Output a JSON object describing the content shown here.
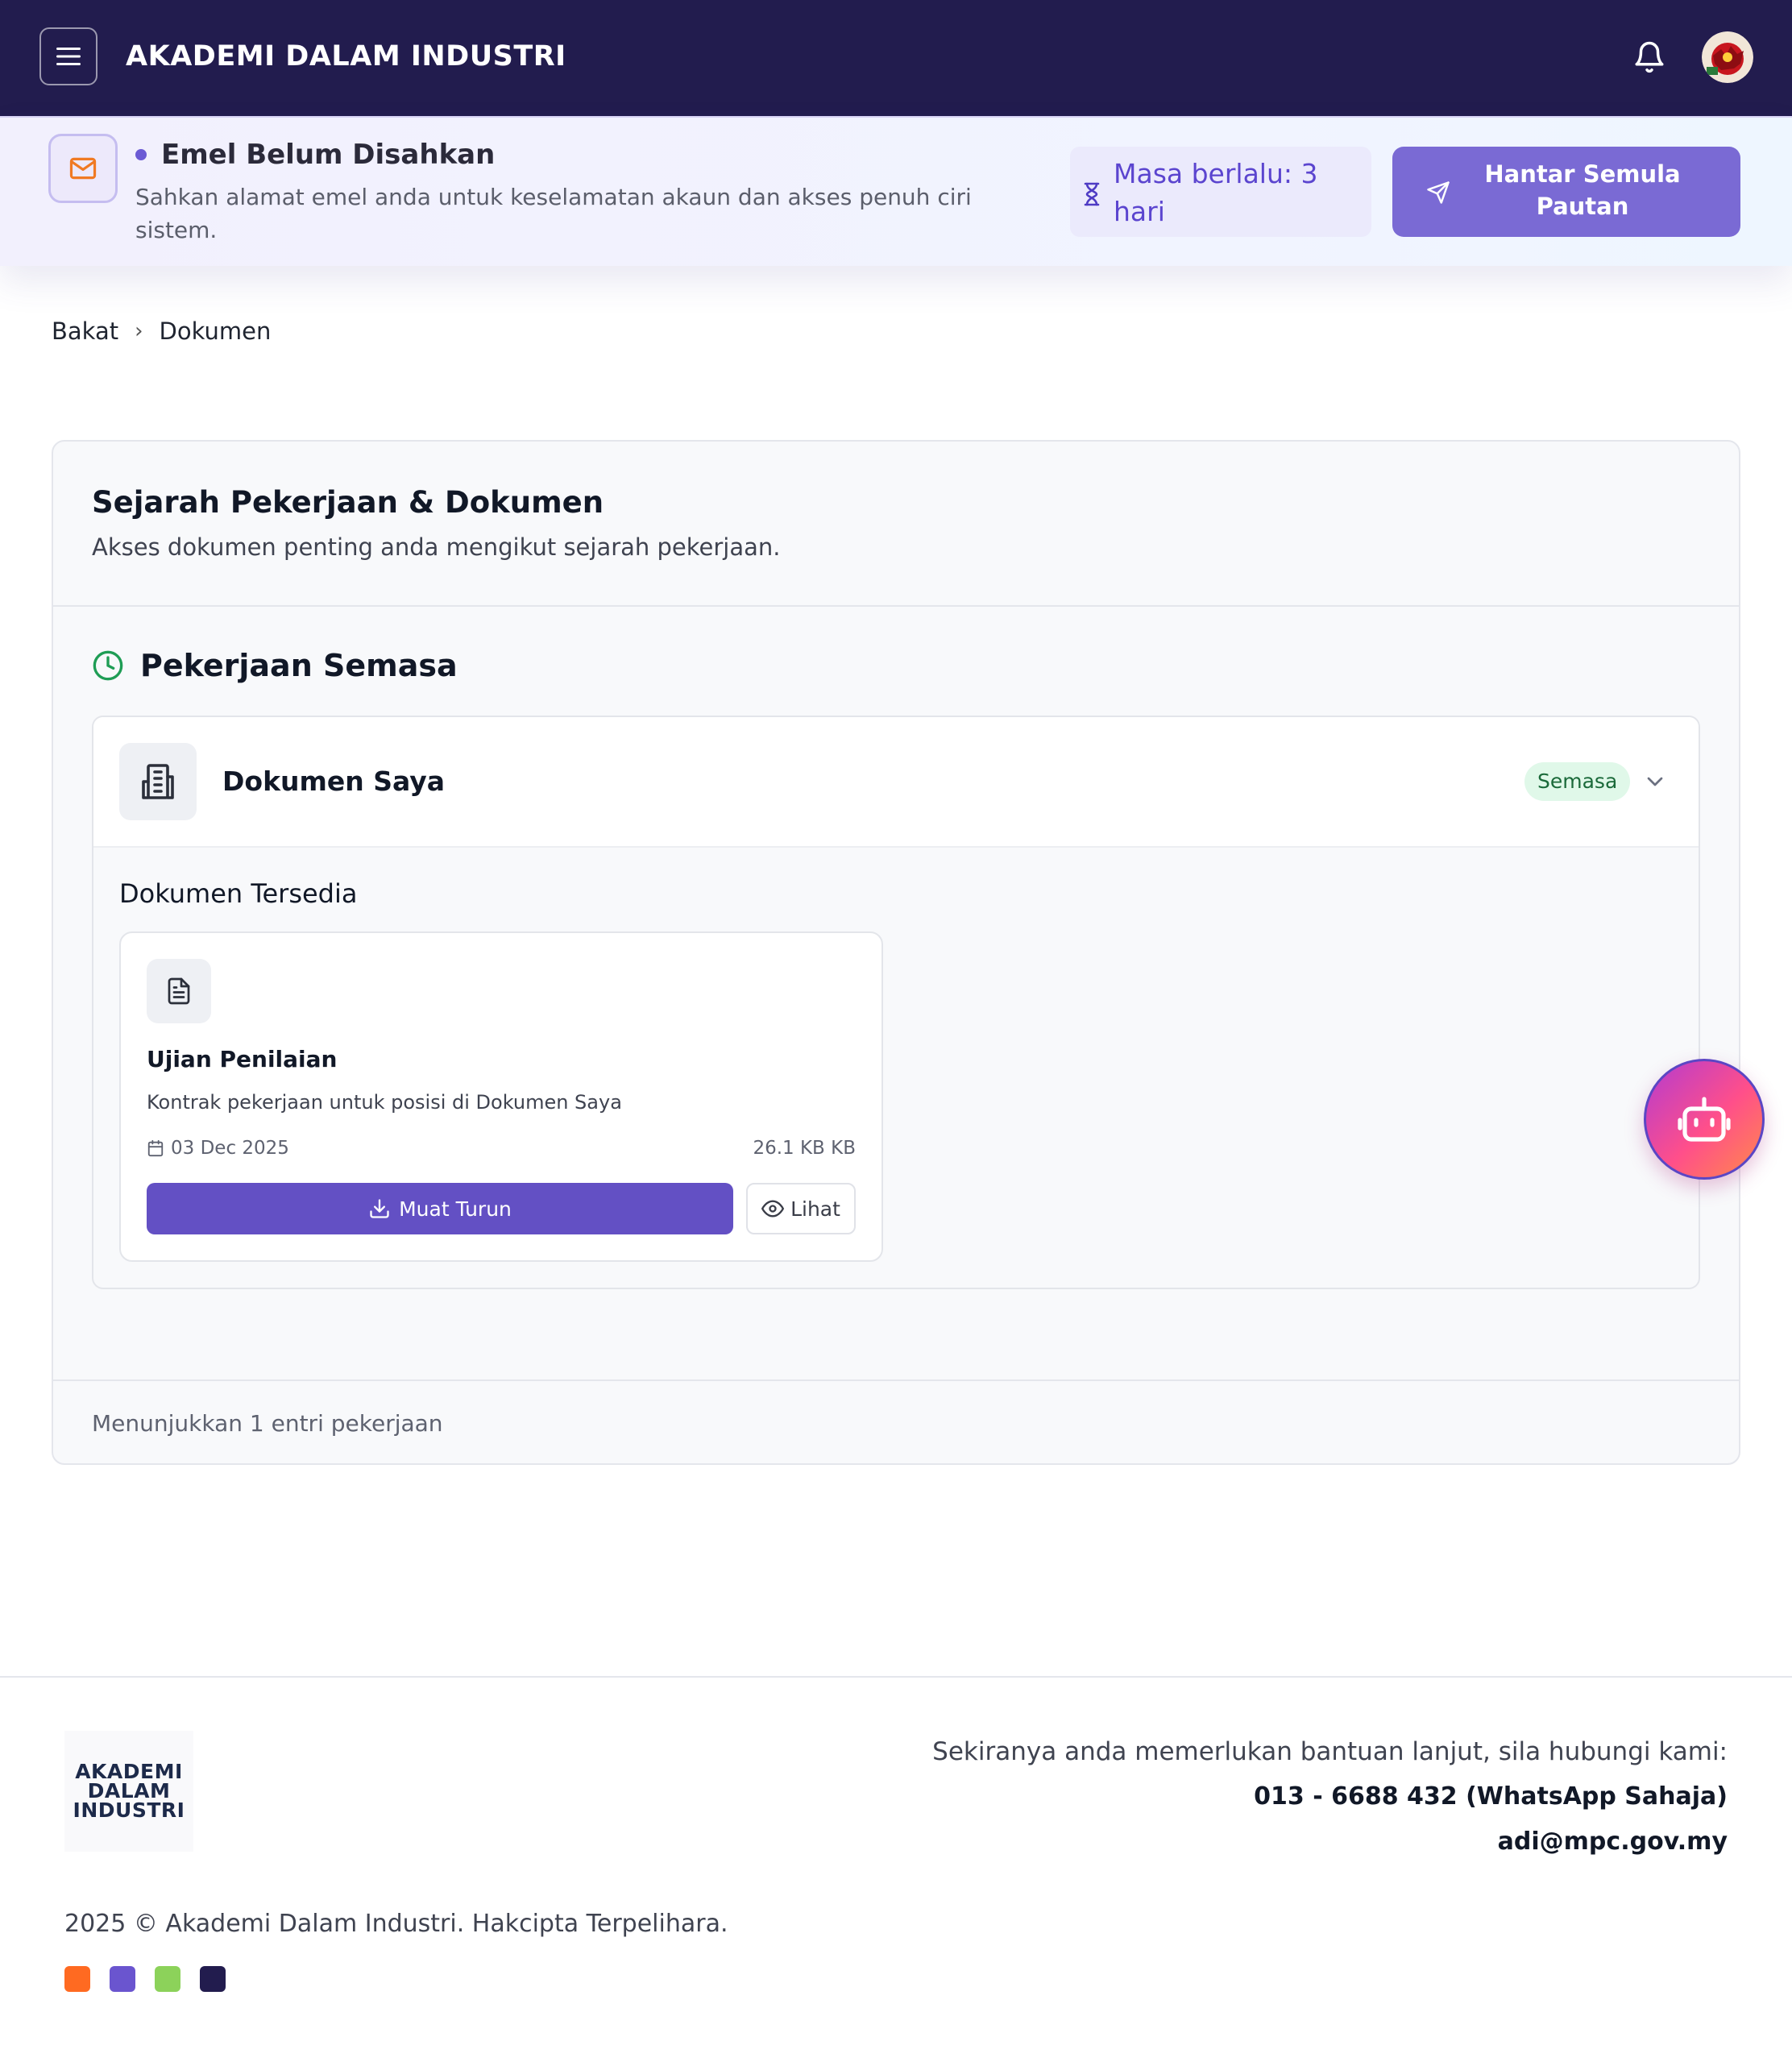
{
  "header": {
    "title": "AKADEMI DALAM INDUSTRI"
  },
  "banner": {
    "title": "Emel Belum Disahkan",
    "description": "Sahkan alamat emel anda untuk keselamatan akaun dan akses penuh ciri sistem.",
    "timer_text": "Masa berlalu: 3 hari",
    "resend_label": "Hantar Semula Pautan"
  },
  "breadcrumb": {
    "items": [
      "Bakat",
      "Dokumen"
    ],
    "separator": "›"
  },
  "card": {
    "title": "Sejarah Pekerjaan & Dokumen",
    "subtitle": "Akses dokumen penting anda mengikut sejarah pekerjaan.",
    "section_title": "Pekerjaan Semasa",
    "job": {
      "name": "Dokumen Saya",
      "status": "Semasa",
      "documents_title": "Dokumen Tersedia",
      "documents": [
        {
          "name": "Ujian Penilaian",
          "description": "Kontrak pekerjaan untuk posisi di Dokumen Saya",
          "date": "03 Dec 2025",
          "size": "26.1 KB KB",
          "download_label": "Muat Turun",
          "view_label": "Lihat"
        }
      ]
    },
    "footer_text": "Menunjukkan 1 entri pekerjaan"
  },
  "footer": {
    "logo_text": "AKADEMI DALAM INDUSTRI",
    "help_text": "Sekiranya anda memerlukan bantuan lanjut, sila hubungi kami:",
    "phone": "013 - 6688 432 (WhatsApp Sahaja)",
    "email": "adi@mpc.gov.my",
    "copyright": "2025 © Akademi Dalam Industri. Hakcipta Terpelihara.",
    "brand_colors": [
      "#ff6a21",
      "#6a55cf",
      "#8cd25a",
      "#221c4e"
    ]
  },
  "colors": {
    "header_bg": "#221c4e",
    "accent": "#6350c4",
    "status_green": "#1f9d55"
  },
  "icons": [
    "menu-icon",
    "bell-icon",
    "mail-icon",
    "hourglass-icon",
    "send-icon",
    "clock-icon",
    "building-icon",
    "chevron-down-icon",
    "file-text-icon",
    "calendar-icon",
    "download-icon",
    "eye-icon",
    "bot-icon"
  ]
}
